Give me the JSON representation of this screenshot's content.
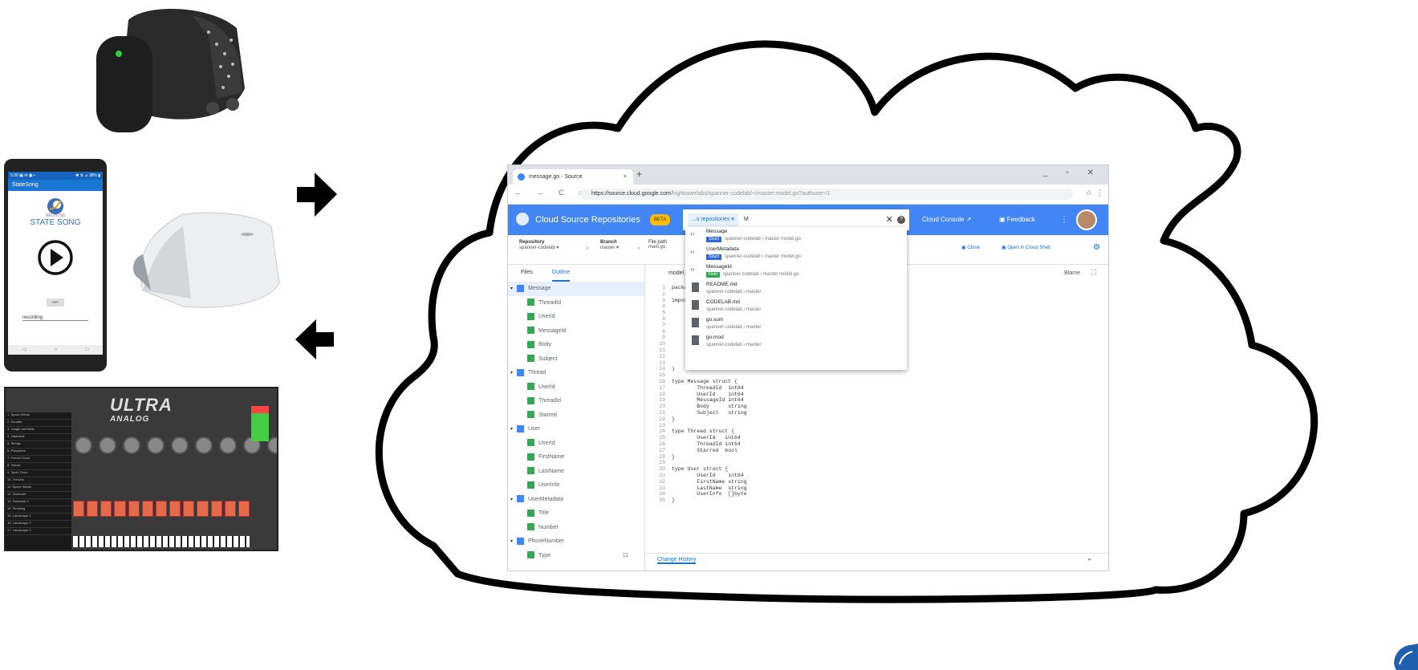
{
  "colors": {
    "accent_blue": "#4285f4",
    "green": "#34a853",
    "beta": "#fbbc05",
    "synth_key": "#e56a4a"
  },
  "phone": {
    "status_left": "5:30 ▣ ✉ ▣ •",
    "status_right": "✱ ⇅ ⊿ 38% ▮",
    "app_title": "StateSong",
    "logo_small": "MEDHUSE",
    "logo": "STATE SONG",
    "button_off": "OFF",
    "recording_label": "recording",
    "nav": [
      "◁",
      "○",
      "□"
    ]
  },
  "synth": {
    "title": "ULTRA",
    "subtitle": "ANALOG",
    "presets": [
      "1. Space Winds",
      "2. Sonatta",
      "3. Jungle and Bells",
      "4. Jawbreak",
      "5. Strings",
      "6. Pulsations",
      "7. Funnel Cloud",
      "8. Vulcan",
      "9. Synth Drum",
      "10. Tremolo",
      "11. Space Winds",
      "12. Sawtooth",
      "13. Sawtooth 2",
      "14. Plodding",
      "15. Landscape 1",
      "16. Landscape 2",
      "17. Landscape 3"
    ]
  },
  "browser": {
    "tab_title": "message.go - Source",
    "tab_close": "×",
    "new_tab": "+",
    "window_controls": "_ ▫ ✕",
    "nav_buttons": "← → C ⌂",
    "url_host": "https://source.cloud.google.com",
    "url_path": "/hightowerlabs/spanner-codelab/+/master:model.go?authuser=1",
    "star": "☆",
    "menu": "⋮",
    "app_name": "Cloud Source Repositories",
    "beta": "BETA",
    "search_scope": "...s repositories ▾",
    "search_query": "M",
    "search_clear": "✕",
    "search_help": "?",
    "cloud_console": "Cloud Console ↗",
    "feedback": "▣ Feedback",
    "more": "⋮",
    "repository_label": "Repository",
    "repository_value": "spanner-codelab ▾",
    "branch_label": "Branch",
    "branch_value": "master ▾",
    "filepath_label": "File path",
    "filepath_value": "main.go",
    "sep": "›",
    "clone": "▣ Clone",
    "open_shell": "▣ Open in Cloud Shell",
    "gear": "⚙",
    "left_tabs": [
      "Files",
      "Outline"
    ],
    "tree": [
      {
        "level": 0,
        "label": "Message",
        "arrow": "▾"
      },
      {
        "level": 1,
        "label": "ThreadId"
      },
      {
        "level": 1,
        "label": "UserId"
      },
      {
        "level": 1,
        "label": "MessageId"
      },
      {
        "level": 1,
        "label": "Body"
      },
      {
        "level": 1,
        "label": "Subject"
      },
      {
        "level": 0,
        "label": "Thread",
        "arrow": "▾"
      },
      {
        "level": 1,
        "label": "UserId"
      },
      {
        "level": 1,
        "label": "ThreadId"
      },
      {
        "level": 1,
        "label": "Starred"
      },
      {
        "level": 0,
        "label": "User",
        "arrow": "▾"
      },
      {
        "level": 1,
        "label": "UserId"
      },
      {
        "level": 1,
        "label": "FirstName"
      },
      {
        "level": 1,
        "label": "LastName"
      },
      {
        "level": 1,
        "label": "UserInfo"
      },
      {
        "level": 0,
        "label": "UserMetadata",
        "arrow": "▾"
      },
      {
        "level": 1,
        "label": "Title"
      },
      {
        "level": 1,
        "label": "Number"
      },
      {
        "level": 0,
        "label": "PhoneNumber",
        "arrow": "▾"
      },
      {
        "level": 1,
        "label": "Type",
        "count": "11"
      }
    ],
    "file_name": "model.go",
    "blame": "Blame",
    "fullscreen": "⛶",
    "code_lines": [
      {
        "n": "1",
        "t": "package main"
      },
      {
        "n": "2",
        "t": ""
      },
      {
        "n": "3",
        "t": "import ("
      },
      {
        "n": "4",
        "t": ""
      },
      {
        "n": "5",
        "t": ""
      },
      {
        "n": "6",
        "t": ""
      },
      {
        "n": "7",
        "t": ""
      },
      {
        "n": "8",
        "t": ""
      },
      {
        "n": "9",
        "t": ""
      },
      {
        "n": "10",
        "t": ""
      },
      {
        "n": "11",
        "t": ""
      },
      {
        "n": "12",
        "t": ""
      },
      {
        "n": "13",
        "t": ""
      },
      {
        "n": "14",
        "t": ")"
      },
      {
        "n": "15",
        "t": ""
      },
      {
        "n": "16",
        "t": "type Message struct {"
      },
      {
        "n": "17",
        "t": "        ThreadId  int64"
      },
      {
        "n": "18",
        "t": "        UserId    int64"
      },
      {
        "n": "19",
        "t": "        MessageId int64"
      },
      {
        "n": "20",
        "t": "        Body      string"
      },
      {
        "n": "21",
        "t": "        Subject   string"
      },
      {
        "n": "22",
        "t": "}"
      },
      {
        "n": "23",
        "t": ""
      },
      {
        "n": "24",
        "t": "type Thread struct {"
      },
      {
        "n": "25",
        "t": "        UserId   int64"
      },
      {
        "n": "26",
        "t": "        ThreadId int64"
      },
      {
        "n": "27",
        "t": "        Starred  bool"
      },
      {
        "n": "28",
        "t": "}"
      },
      {
        "n": "29",
        "t": ""
      },
      {
        "n": "30",
        "t": "type User struct {"
      },
      {
        "n": "31",
        "t": "        UserId    int64"
      },
      {
        "n": "32",
        "t": "        FirstName string"
      },
      {
        "n": "33",
        "t": "        LastName  string"
      },
      {
        "n": "34",
        "t": "        UserInfo  []byte"
      },
      {
        "n": "35",
        "t": "}"
      }
    ],
    "change_history": "Change History",
    "collapse": "⌃",
    "dropdown": [
      {
        "kind": "symbol",
        "title": "Message",
        "badge": "Struct",
        "badge_type": "struct",
        "sub": "spanner-codelab › master  model.go"
      },
      {
        "kind": "symbol",
        "title": "UserMetadata",
        "badge": "Struct",
        "badge_type": "struct",
        "sub": "spanner-codelab › master  model.go"
      },
      {
        "kind": "symbol",
        "title": "MessageId",
        "badge": "Field",
        "badge_type": "field",
        "sub": "spanner-codelab › master  model.go"
      },
      {
        "kind": "file",
        "title": "README.md",
        "sub": "spanner-codelab › master"
      },
      {
        "kind": "file",
        "title": "CODELAB.md",
        "sub": "spanner-codelab › master"
      },
      {
        "kind": "file",
        "title": "go.sum",
        "sub": "spanner-codelab › master"
      },
      {
        "kind": "file",
        "title": "go.mod",
        "sub": "spanner-codelab › master"
      }
    ],
    "symbol_icon": "‹›"
  }
}
